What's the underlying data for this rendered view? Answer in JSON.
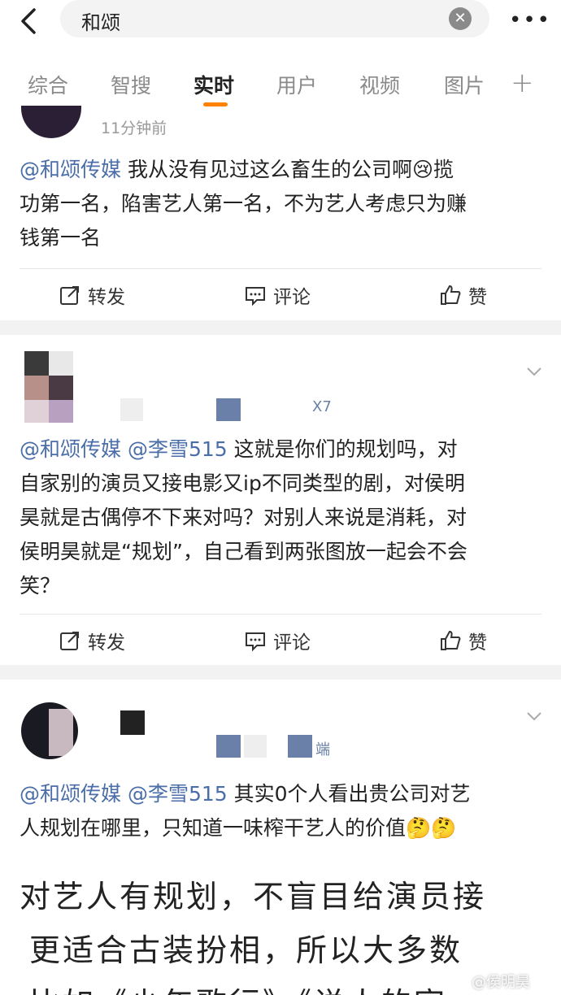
{
  "search": {
    "query": "和颂"
  },
  "tabs": [
    {
      "label": "综合"
    },
    {
      "label": "智搜"
    },
    {
      "label": "实时"
    },
    {
      "label": "用户"
    },
    {
      "label": "视频"
    },
    {
      "label": "图片"
    }
  ],
  "post1": {
    "time": "11分钟前",
    "mention": "@和颂传媒",
    "text_line1": " 我从没有见过这么畜生的公司啊",
    "emoji": "😢",
    "text_line1_end": "揽",
    "text_line2": "功第一名，陷害艺人第一名，不为艺人考虑只为赚",
    "text_line3": "钱第一名"
  },
  "post2": {
    "meta": "X7",
    "mention": "@和颂传媒 @李雪515",
    "text_line1": " 这就是你们的规划吗，对",
    "text_line2": "自家别的演员又接电影又ip不同类型的剧，对侯明",
    "text_line3": "昊就是古偶停不下来对吗？对别人来说是消耗，对",
    "text_line4": "侯明昊就是“规划”，自己看到两张图放一起会不会",
    "text_line5": "笑？"
  },
  "post3": {
    "meta": "端",
    "mention": "@和颂传媒 @李雪515",
    "text_line1": " 其实0个人看出贵公司对艺",
    "text_line2": "人规划在哪里，只知道一味榨干艺人的价值",
    "emoji": "🤔🤔",
    "image_line1": "对艺人有规划，不盲目给演员接",
    "image_line2": "更适合古装扮相，所以大多数",
    "image_line3": "比如《少年歌行》《说人的官"
  },
  "actions": {
    "repost": "转发",
    "comment": "评论",
    "like": "赞"
  },
  "watermark": "@侯明昊"
}
